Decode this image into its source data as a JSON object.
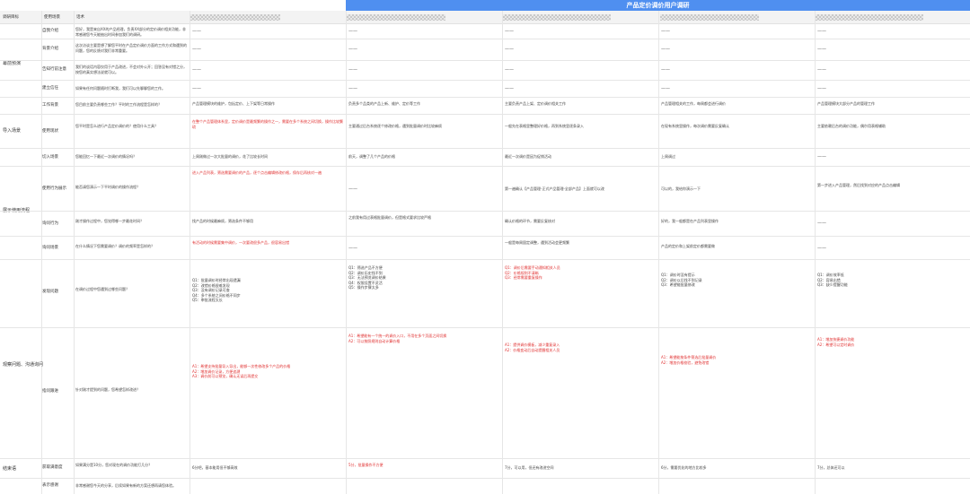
{
  "title": "产品定价调价用户调研",
  "headers": {
    "col1": "调研目标",
    "col2": "使用场景",
    "col3": "话术"
  },
  "groups": {
    "g1": "幕前预演",
    "g2": "导入场景",
    "g3": "展示使用流程",
    "g4": "观察问题、沟通询问",
    "g5": "结束语"
  },
  "questions": {
    "q1": "自我介绍",
    "q2": "背景介绍",
    "q3": "告知行前注意",
    "q4": "建立信任",
    "q5": "工作背景",
    "q6": "使用现状",
    "q7": "切入场景",
    "q8": "使用行为展示",
    "q9": "询问行为",
    "q10": "询问场景",
    "q11": "发现问题",
    "q12": "指问跟进",
    "q13": "获取满意度",
    "q14": "表示感谢"
  },
  "rows": {
    "r1_script": "您好，我是来自XX的产品经理，负责XX部分的定价调价相关功能，非常感谢您今天能抽出时间参加我们的调研。",
    "r2_script": "这次访谈主要是想了解您平时在产品定价调价方面的工作方式和遇到的问题，您的反馈对我们非常重要。",
    "r3_script": "我们的谈话内容仅用于产品改进，不会对外公开；回答没有对错之分，按您的真实想法说就可以。",
    "r4_script": "如果有任何问题随时打断我，我们可以先聊聊您的工作。",
    "r5_script": "您目前主要负责哪些工作？平时的工作流程是怎样的？",
    "r5_a1": "产品管理模块的维护，包括定价、上下架等日常操作",
    "r5_a2": "负责多个品类的产品上新、维护、定价等工作",
    "r5_a3": "主要负责产品上架、定价调价相关工作",
    "r5_a4": "产品管理相关的工作，每周都会进行调价",
    "r5_a5": "产品管理模块大部分产品的管理工作",
    "r6_script": "您平时是怎么进行产品定价调价的？使用什么工具？",
    "r6_a1": "在整个产品管理体系里，定价调价是最频繁的操作之一，需要在多个系统之间切换，操作比较繁琐",
    "r6_a2": "主要通过后台系统逐个修改价格，遇到批量调价时比较麻烦",
    "r6_a3": "一般先在表格里整理好价格，再到系统里逐条录入",
    "r6_a4": "在现有系统里操作，每次调价需要反复确认",
    "r6_a5": "主要依赖后台的调价功能，偶尔用表格辅助",
    "r7_script": "您能回忆一下最近一次调价的情况吗？",
    "r7_a1": "上周刚做过一次大批量的调价，花了比较长时间",
    "r7_a2": "前天，调整了几个产品的价格",
    "r7_a3": "最近一次调价是因为促销活动",
    "r7_a4": "上周调过",
    "r8_script": "能否请您演示一下平时调价的操作流程？",
    "r8_a1": "进入产品列表，筛选需要调价的产品，逐个点击编辑修改价格，保存后再核对一遍",
    "r8_a2": "先导出产品清单，在表格里修改后再导入",
    "r8_a3": "第一遍确认【产品管理-正式产品管理-全部产品】上面就可以改",
    "r8_a4": "可以的，我给你演示一下",
    "r8_a5": "第一步进入产品管理，然后找到对应的产品点击编辑",
    "r9_script": "刚才操作过程中，您觉得哪一步最花时间？",
    "r9_a1": "找产品的时候最麻烦，筛选条件不够用",
    "r9_a2": "之前我有用过表格批量调价，但是格式要求比较严格",
    "r9_a3": "确认价格的环节，需要反复核对",
    "r9_a4": "好的，我一般都是在产品列表里操作",
    "r10_script": "在什么情况下您需要调价？调价的频率是怎样的？",
    "r10_a1": "有活动的时候需要集中调价，一次要改很多产品，很容易出错",
    "r10_a2": "换季或者成本变动的时候，频率不固定",
    "r10_a3": "一般是每周固定调整，遇到活动会更频繁",
    "r10_a4": "产品的定价和上架前定价都需要做",
    "r11_script": "在调价过程中您遇到过哪些问题？",
    "r11_a1": "Q1：批量调价时经常出现遗漏\nQ2：改错价格很难发现\nQ3：没有调价记录可查\nQ4：多个系统之间价格不同步\nQ5：审批流程太长",
    "r11_a2": "Q1：筛选产品不方便\nQ2：调价历史找不到\nQ3：无法预览调价结果\nQ4：权限设置不灵活\nQ5：操作步骤太多",
    "r11_a3": "Q1：调价后需要手动通知相关人员\nQ2：价格规则不清晰\nQ3：经常需要重复操作",
    "r11_a4": "Q1：调价时没有提示\nQ2：调价以后找不到记录\nQ3：希望能批量修改",
    "r11_a5": "Q1：调价效率低\nQ2：容易出错\nQ3：缺少提醒功能",
    "r12_script": "针对刚才提到的问题，您希望怎样改进？",
    "r12_a1": "A1：希望支持批量导入导出，能够一次性修改多个产品的价格\nA2：增加调价记录，方便追溯\nA3：调价前可以预览，确认无误后再提交",
    "r12_a2": "A1：希望能有一个统一的调价入口，不用在多个页面之间切换\nA2：可以按照规则自动计算价格",
    "r12_a3": "A1：提供调价模板，减少重复录入\nA2：价格变动后自动提醒相关人员",
    "r12_a4": "A1：希望能按条件筛选后批量调价\nA2：增加价格校验，避免改错",
    "r12_a5": "A1：增加快捷调价功能\nA2：希望可以定时调价",
    "r13_script": "如果满分是10分，您对现在的调价功能打几分？",
    "r13_a1": "6分吧，基本能用但不够高效",
    "r13_a2": "5分，批量操作不方便",
    "r13_a3": "7分，可以用，但还有改进空间",
    "r13_a4": "6分，需要优化的地方比较多",
    "r13_a5": "7分，总体还可以",
    "r14_script": "非常感谢您今天的分享，后续如果有新的方案还想再请您体验。"
  },
  "dash": "——"
}
